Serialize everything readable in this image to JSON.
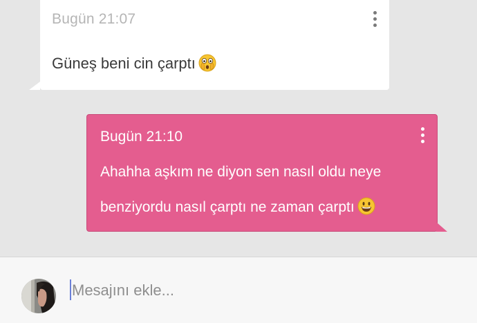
{
  "messages": [
    {
      "direction": "incoming",
      "time": "Bugün 21:07",
      "lines": [
        "Güneş beni cin çarptı"
      ],
      "emoji": "face-with-hand-over-mouth-icon"
    },
    {
      "direction": "outgoing",
      "time": "Bugün 21:10",
      "lines": [
        "Ahahha aşkım ne diyon sen nasıl oldu neye",
        "benziyordu nasıl çarptı ne zaman çarptı"
      ],
      "emoji": "smiley-face-icon"
    }
  ],
  "composer": {
    "placeholder": "Mesajını ekle...",
    "value": ""
  },
  "colors": {
    "background": "#e6e6e6",
    "incoming_bubble": "#ffffff",
    "outgoing_bubble": "#e45d8f",
    "caret": "#6b7fd7"
  }
}
